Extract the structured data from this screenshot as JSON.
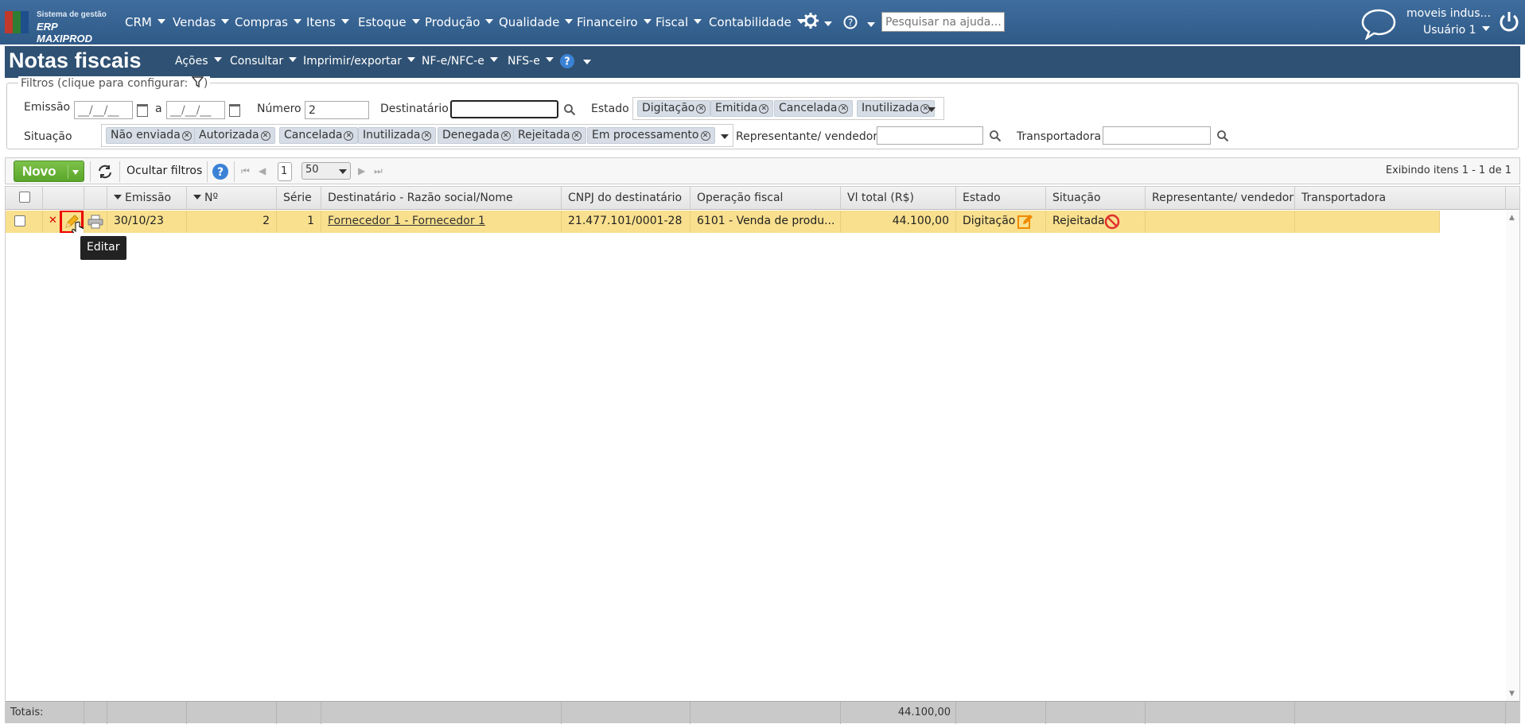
{
  "app": {
    "logo_line1": "Sistema de gestão",
    "logo_line2": "ERP MAXIPROD",
    "menu": [
      "CRM",
      "Vendas",
      "Compras",
      "Itens",
      "Estoque",
      "Produção",
      "Qualidade",
      "Financeiro",
      "Fiscal",
      "Contabilidade"
    ],
    "help_search_placeholder": "Pesquisar na ajuda...",
    "company": "moveis indus...",
    "user": "Usuário 1"
  },
  "page": {
    "title": "Notas fiscais",
    "menu": [
      "Ações",
      "Consultar",
      "Imprimir/exportar",
      "NF-e/NFC-e",
      "NFS-e"
    ]
  },
  "filters": {
    "legend": "Filtros (clique para configurar:",
    "legend_close": ")",
    "emissao_label": "Emissão",
    "date_placeholder": "__/__/__",
    "date_sep": "a",
    "numero_label": "Número",
    "numero_value": "2",
    "destinatario_label": "Destinatário",
    "destinatario_value": "",
    "estado_label": "Estado",
    "estado_tags": [
      "Digitação",
      "Emitida",
      "Cancelada",
      "Inutilizada"
    ],
    "situacao_label": "Situação",
    "situacao_tags": [
      "Não enviada",
      "Autorizada",
      "Cancelada",
      "Inutilizada",
      "Denegada",
      "Rejeitada",
      "Em processamento"
    ],
    "representante_label": "Representante/ vendedor",
    "transportadora_label": "Transportadora"
  },
  "toolbar": {
    "novo_label": "Novo",
    "ocultar_filtros": "Ocultar filtros",
    "page_number": "1",
    "page_size": "50",
    "showing": "Exibindo itens 1 - 1 de 1"
  },
  "grid": {
    "columns": [
      "Emissão",
      "Nº",
      "Série",
      "Destinatário - Razão social/Nome",
      "CNPJ do destinatário",
      "Operação fiscal",
      "Vl total (R$)",
      "Estado",
      "Situação",
      "Representante/ vendedor",
      "Transportadora"
    ],
    "rows": [
      {
        "emissao": "30/10/23",
        "numero": "2",
        "serie": "1",
        "destinatario": "Fornecedor 1 - Fornecedor 1",
        "cnpj": "21.477.101/0001-28",
        "operacao": "6101 - Venda de produ...",
        "vl_total": "44.100,00",
        "estado": "Digitação",
        "situacao": "Rejeitada",
        "representante": "",
        "transportadora": ""
      }
    ],
    "totals_label": "Totais:",
    "totals_vl": "44.100,00"
  },
  "tooltip": "Editar",
  "colors": {
    "topbar": "#3a6795",
    "pagehead": "#2f5173",
    "row_selected": "#f9e08e",
    "novo_button": "#6db43a",
    "edit_highlight": "#e00000"
  }
}
